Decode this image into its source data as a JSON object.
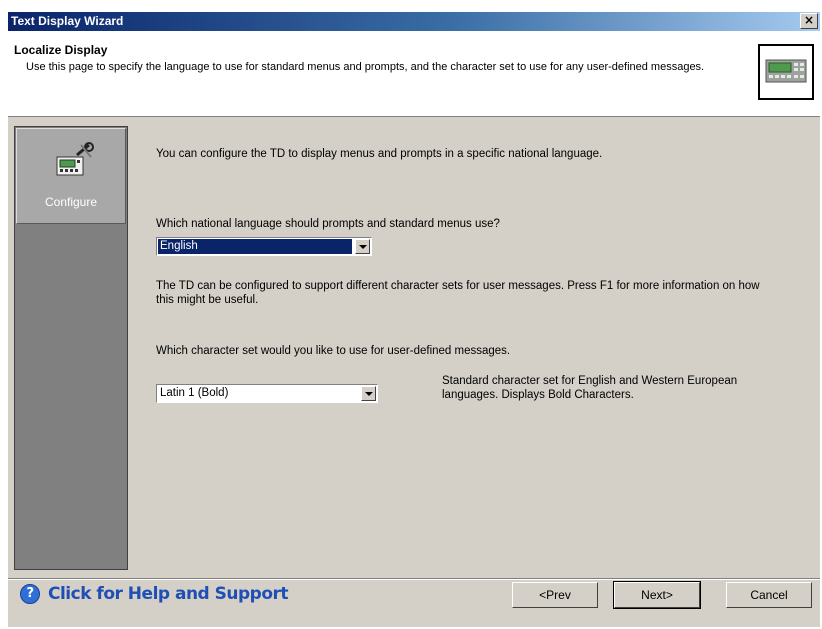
{
  "window": {
    "title": "Text Display Wizard",
    "close_glyph": "×"
  },
  "header": {
    "title": "Localize Display",
    "description": "Use this page to specify the language to use for standard menus and prompts, and the character set to use for any user-defined messages.",
    "icon": "text-display-device-icon"
  },
  "sidebar": {
    "items": [
      {
        "label": "Configure",
        "icon": "configure-display-icon"
      }
    ]
  },
  "main": {
    "intro": "You can configure the TD to display menus and prompts in a specific national language.",
    "language_question": "Which national language should prompts and standard menus use?",
    "language_value": "English",
    "charset_info": "The TD can be configured to support different character sets for user messages. Press F1 for more information on how this might be useful.",
    "charset_question": "Which character set would you like to use for user-defined messages.",
    "charset_value": "Latin 1 (Bold)",
    "charset_description": "Standard character set for English and Western European languages. Displays Bold Characters."
  },
  "footer": {
    "help_label": "Click for Help and Support",
    "prev_label": "<Prev",
    "next_label": "Next>",
    "cancel_label": "Cancel"
  },
  "colors": {
    "title_bar": "#0a246a",
    "dialog_bg": "#d4d0c8",
    "sidebar_bg": "#808080",
    "selection": "#0a246a",
    "help_text": "#1f4fb5"
  }
}
